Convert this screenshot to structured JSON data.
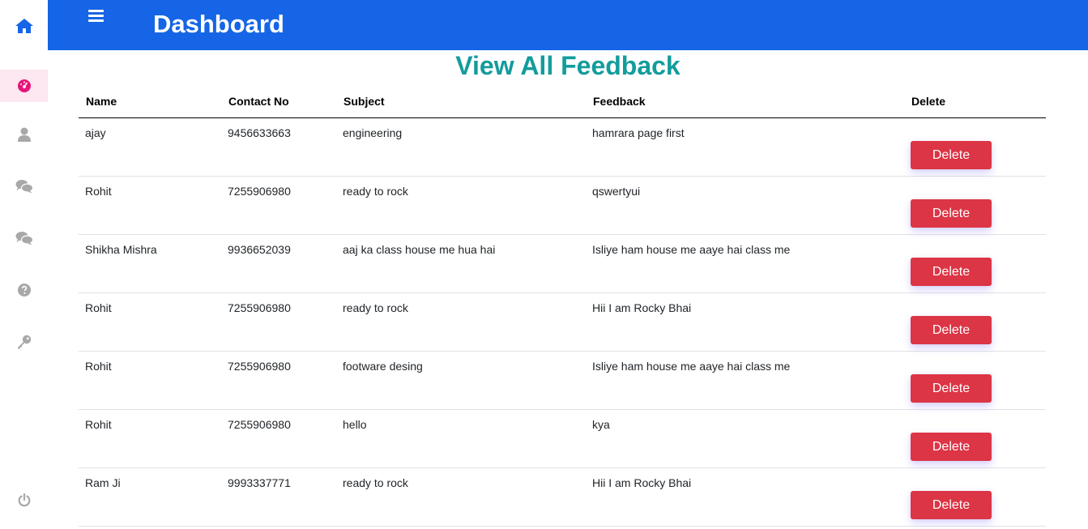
{
  "header": {
    "title": "Dashboard"
  },
  "main": {
    "heading": "View All Feedback"
  },
  "sidebar": {
    "items": [
      {
        "icon": "home-icon",
        "color": "#1565e6"
      },
      {
        "icon": "dashboard-icon",
        "color": "#e6157a",
        "active": true
      },
      {
        "icon": "user-icon",
        "color": "#a8a8a8"
      },
      {
        "icon": "comments-icon",
        "color": "#a8a8a8"
      },
      {
        "icon": "comments-icon",
        "color": "#a8a8a8"
      },
      {
        "icon": "question-circle-icon",
        "color": "#a8a8a8"
      },
      {
        "icon": "key-icon",
        "color": "#a8a8a8"
      },
      {
        "icon": "power-icon",
        "color": "#a8a8a8"
      }
    ]
  },
  "table": {
    "columns": [
      "Name",
      "Contact No",
      "Subject",
      "Feedback",
      "Delete"
    ],
    "delete_label": "Delete",
    "rows": [
      {
        "name": "ajay",
        "contact": "9456633663",
        "subject": "engineering",
        "feedback": "hamrara page first"
      },
      {
        "name": "Rohit",
        "contact": "7255906980",
        "subject": "ready to rock",
        "feedback": "qswertyui"
      },
      {
        "name": "Shikha Mishra",
        "contact": "9936652039",
        "subject": "aaj ka class house me hua hai",
        "feedback": "Isliye ham house me aaye hai class me"
      },
      {
        "name": "Rohit",
        "contact": "7255906980",
        "subject": "ready to rock",
        "feedback": "Hii I am Rocky Bhai"
      },
      {
        "name": "Rohit",
        "contact": "7255906980",
        "subject": "footware desing",
        "feedback": "Isliye ham house me aaye hai class me"
      },
      {
        "name": "Rohit",
        "contact": "7255906980",
        "subject": "hello",
        "feedback": "kya"
      },
      {
        "name": "Ram Ji",
        "contact": "9993337771",
        "subject": "ready to rock",
        "feedback": "Hii I am Rocky Bhai"
      }
    ]
  },
  "colors": {
    "topbar": "#1565e6",
    "heading": "#139c9c",
    "delete_button": "#dc3545"
  }
}
